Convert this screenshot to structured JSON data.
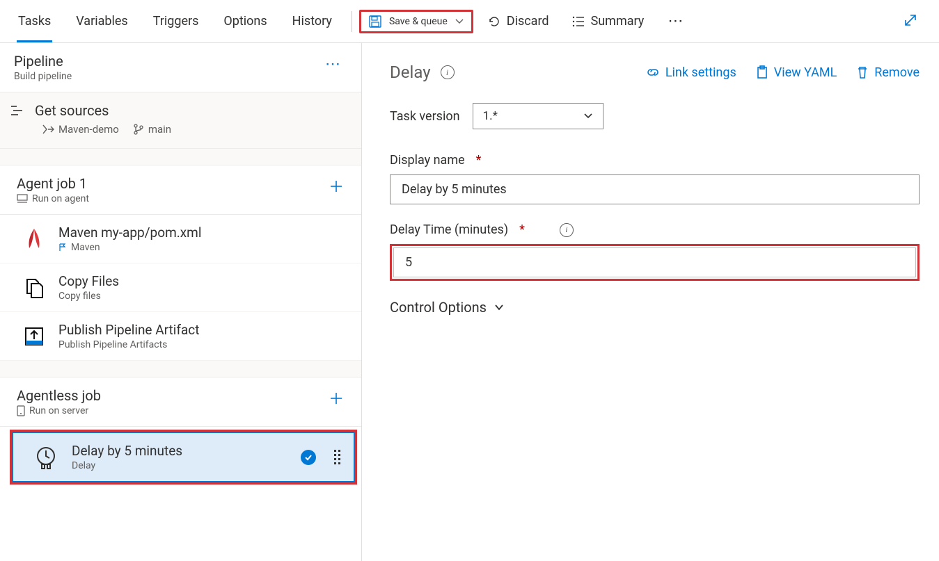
{
  "tabs": [
    "Tasks",
    "Variables",
    "Triggers",
    "Options",
    "History"
  ],
  "active_tab_index": 0,
  "toolbar": {
    "save_queue": "Save & queue",
    "discard": "Discard",
    "summary": "Summary"
  },
  "pipeline": {
    "title": "Pipeline",
    "subtitle": "Build pipeline"
  },
  "sources": {
    "title": "Get sources",
    "repo": "Maven-demo",
    "branch": "main"
  },
  "agent_job": {
    "title": "Agent job 1",
    "subtitle": "Run on agent",
    "tasks": [
      {
        "name": "Maven my-app/pom.xml",
        "type": "Maven",
        "icon": "maven"
      },
      {
        "name": "Copy Files",
        "type": "Copy files",
        "icon": "copy"
      },
      {
        "name": "Publish Pipeline Artifact",
        "type": "Publish Pipeline Artifacts",
        "icon": "publish"
      }
    ]
  },
  "agentless_job": {
    "title": "Agentless job",
    "subtitle": "Run on server",
    "tasks": [
      {
        "name": "Delay by 5 minutes",
        "type": "Delay",
        "icon": "delay",
        "selected": true
      }
    ]
  },
  "detail": {
    "title": "Delay",
    "links": {
      "link_settings": "Link settings",
      "view_yaml": "View YAML",
      "remove": "Remove"
    },
    "task_version_label": "Task version",
    "task_version_value": "1.*",
    "display_name_label": "Display name",
    "display_name_value": "Delay by 5 minutes",
    "delay_time_label": "Delay Time (minutes)",
    "delay_time_value": "5",
    "control_options_label": "Control Options"
  }
}
